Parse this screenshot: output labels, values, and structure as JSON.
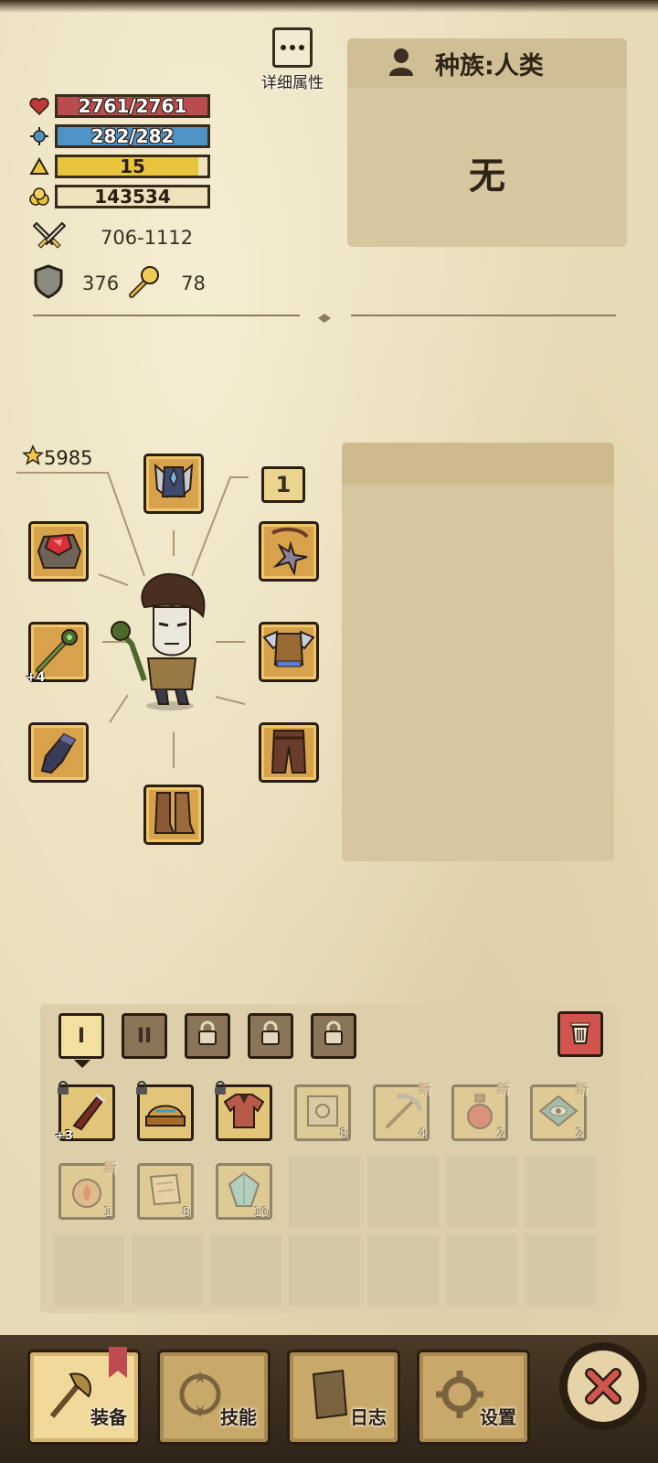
{
  "stats": {
    "hp": "2761/2761",
    "mp": "282/282",
    "level": "15",
    "gold": "143534",
    "attack": "706-1112",
    "defense": "376",
    "magic": "78"
  },
  "detail": {
    "label": "详细属性"
  },
  "race": {
    "title": "种族:人类",
    "value": "无"
  },
  "equipment": {
    "power": "5985",
    "level_tag": "1"
  },
  "equip_slot_weapon_plus": "+4",
  "inventory": {
    "tabs": [
      "I",
      "II"
    ],
    "items": [
      {
        "name": "weapon",
        "plus": "+3",
        "locked": true,
        "count": ""
      },
      {
        "name": "helmet",
        "locked": true,
        "count": ""
      },
      {
        "name": "armor",
        "locked": true,
        "count": ""
      },
      {
        "name": "scroll",
        "count": "8",
        "new": ""
      },
      {
        "name": "pickaxe",
        "count": "4",
        "new": "新"
      },
      {
        "name": "potion",
        "count": "2",
        "new": "新"
      },
      {
        "name": "eye-rune",
        "count": "2",
        "new": "新"
      },
      {
        "name": "fire-flask",
        "count": "1",
        "new": "新"
      },
      {
        "name": "map-scroll",
        "count": "8",
        "new": ""
      },
      {
        "name": "crystal",
        "count": "10",
        "new": ""
      }
    ]
  },
  "nav": {
    "equip": "装备",
    "skills": "技能",
    "log": "日志",
    "settings": "设置"
  },
  "colors": {
    "hp": "#b94c4f",
    "mp": "#4f92c5",
    "xp": "#e9c53e",
    "close": "#d2544f"
  }
}
